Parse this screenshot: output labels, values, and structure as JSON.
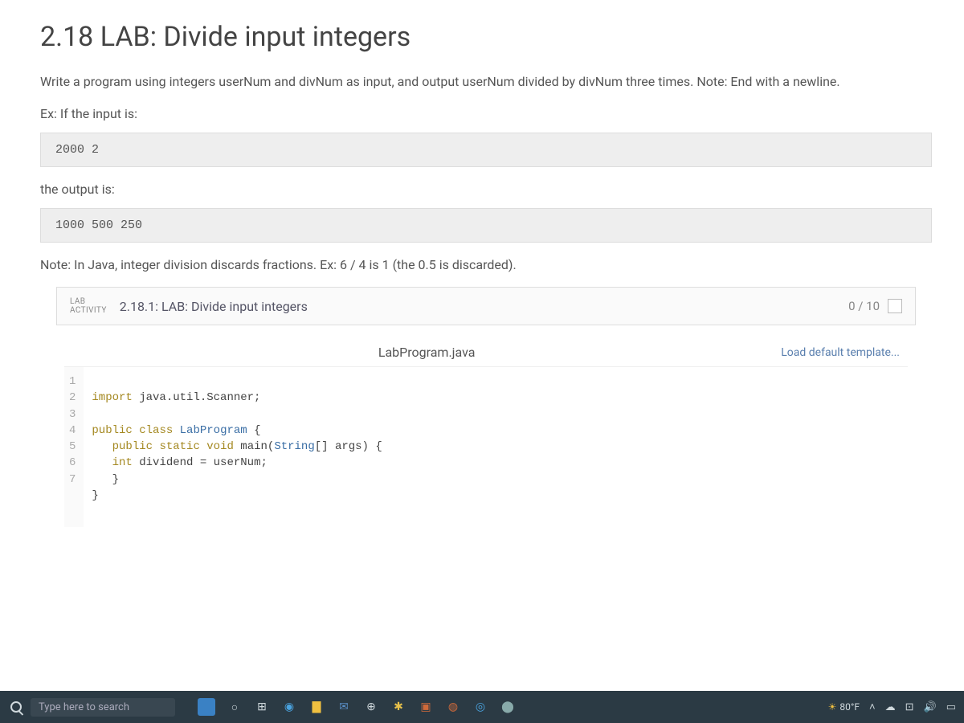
{
  "title": "2.18 LAB: Divide input integers",
  "description": "Write a program using integers userNum and divNum as input, and output userNum divided by divNum three times. Note: End with a newline.",
  "example_intro": "Ex: If the input is:",
  "example_input": "2000 2",
  "output_intro": "the output is:",
  "example_output": "1000 500 250",
  "note": "Note: In Java, integer division discards fractions. Ex: 6 / 4 is 1 (the 0.5 is discarded).",
  "attribution": "",
  "activity": {
    "badge_line1": "LAB",
    "badge_line2": "ACTIVITY",
    "title": "2.18.1: LAB: Divide input integers",
    "score": "0 / 10"
  },
  "editor": {
    "filename": "LabProgram.java",
    "load_template": "Load default template...",
    "lines": [
      {
        "n": "1",
        "text": "import java.util.Scanner;"
      },
      {
        "n": "2",
        "text": ""
      },
      {
        "n": "3",
        "text": "public class LabProgram {"
      },
      {
        "n": "4",
        "text": "   public static void main(String[] args) {"
      },
      {
        "n": "5",
        "text": "   int dividend = userNum;"
      },
      {
        "n": "6",
        "text": "   }"
      },
      {
        "n": "7",
        "text": "}"
      }
    ]
  },
  "taskbar": {
    "search_placeholder": "Type here to search",
    "weather": "80°F"
  }
}
